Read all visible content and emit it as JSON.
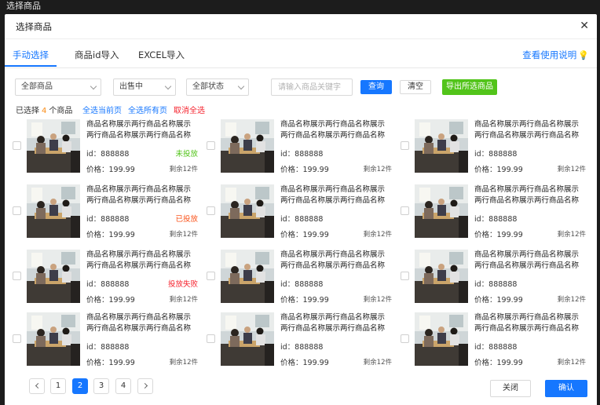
{
  "window": {
    "title": "选择商品"
  },
  "dialog": {
    "title": "选择商品",
    "close_icon": "close-icon"
  },
  "tabs": [
    {
      "label": "手动选择",
      "active": true
    },
    {
      "label": "商品id导入",
      "active": false
    },
    {
      "label": "EXCEL导入",
      "active": false
    }
  ],
  "help_link": "查看使用说明",
  "filters": {
    "category": "全部商品",
    "sale_status": "出售中",
    "state": "全部状态",
    "search_placeholder": "请输入商品关键字",
    "query_label": "查询",
    "clear_label": "清空",
    "export_label": "导出所选商品"
  },
  "selection": {
    "prefix": "已选择",
    "count": "4",
    "suffix": "个商品",
    "select_page": "全选当前页",
    "select_all": "全选所有页",
    "cancel_all": "取消全选"
  },
  "products": [
    {
      "name": "商品名称展示两行商品名称展示两行商品名称展示两行商品名称",
      "id": "id：888888",
      "status": "未投放",
      "status_color": "#52c41a",
      "price": "价格：199.99",
      "stock": "剩余12件"
    },
    {
      "name": "商品名称展示两行商品名称展示两行商品名称展示两行商品名称",
      "id": "id：888888",
      "status": "",
      "status_color": "",
      "price": "价格：199.99",
      "stock": "剩余12件"
    },
    {
      "name": "商品名称展示两行商品名称展示两行商品名称展示两行商品名称",
      "id": "id：888888",
      "status": "",
      "status_color": "",
      "price": "价格：199.99",
      "stock": "剩余12件"
    },
    {
      "name": "商品名称展示两行商品名称展示两行商品名称展示两行商品名称",
      "id": "id：888888",
      "status": "已投放",
      "status_color": "#fa541c",
      "price": "价格：199.99",
      "stock": "剩余12件"
    },
    {
      "name": "商品名称展示两行商品名称展示两行商品名称展示两行商品名称",
      "id": "id：888888",
      "status": "",
      "status_color": "",
      "price": "价格：199.99",
      "stock": "剩余12件"
    },
    {
      "name": "商品名称展示两行商品名称展示两行商品名称展示两行商品名称",
      "id": "id：888888",
      "status": "",
      "status_color": "",
      "price": "价格：199.99",
      "stock": "剩余12件"
    },
    {
      "name": "商品名称展示两行商品名称展示两行商品名称展示两行商品名称",
      "id": "id：888888",
      "status": "投放失败",
      "status_color": "#f5222d",
      "price": "价格：199.99",
      "stock": "剩余12件"
    },
    {
      "name": "商品名称展示两行商品名称展示两行商品名称展示两行商品名称",
      "id": "id：888888",
      "status": "",
      "status_color": "",
      "price": "价格：199.99",
      "stock": "剩余12件"
    },
    {
      "name": "商品名称展示两行商品名称展示两行商品名称展示两行商品名称",
      "id": "id：888888",
      "status": "",
      "status_color": "",
      "price": "价格：199.99",
      "stock": "剩余12件"
    },
    {
      "name": "商品名称展示两行商品名称展示两行商品名称展示两行商品名称",
      "id": "id：888888",
      "status": "",
      "status_color": "",
      "price": "价格：199.99",
      "stock": "剩余12件"
    },
    {
      "name": "商品名称展示两行商品名称展示两行商品名称展示两行商品名称",
      "id": "id：888888",
      "status": "",
      "status_color": "",
      "price": "价格：199.99",
      "stock": "剩余12件"
    },
    {
      "name": "商品名称展示两行商品名称展示两行商品名称展示两行商品名称",
      "id": "id：888888",
      "status": "",
      "status_color": "",
      "price": "价格：199.99",
      "stock": "剩余12件"
    }
  ],
  "pagination": {
    "pages": [
      "1",
      "2",
      "3",
      "4"
    ],
    "current": "2"
  },
  "footer": {
    "close_label": "关闭",
    "confirm_label": "确认"
  },
  "colors": {
    "accent": "#1677ff",
    "export": "#52c41a",
    "danger": "#f5222d",
    "warning": "#fa8c16"
  }
}
